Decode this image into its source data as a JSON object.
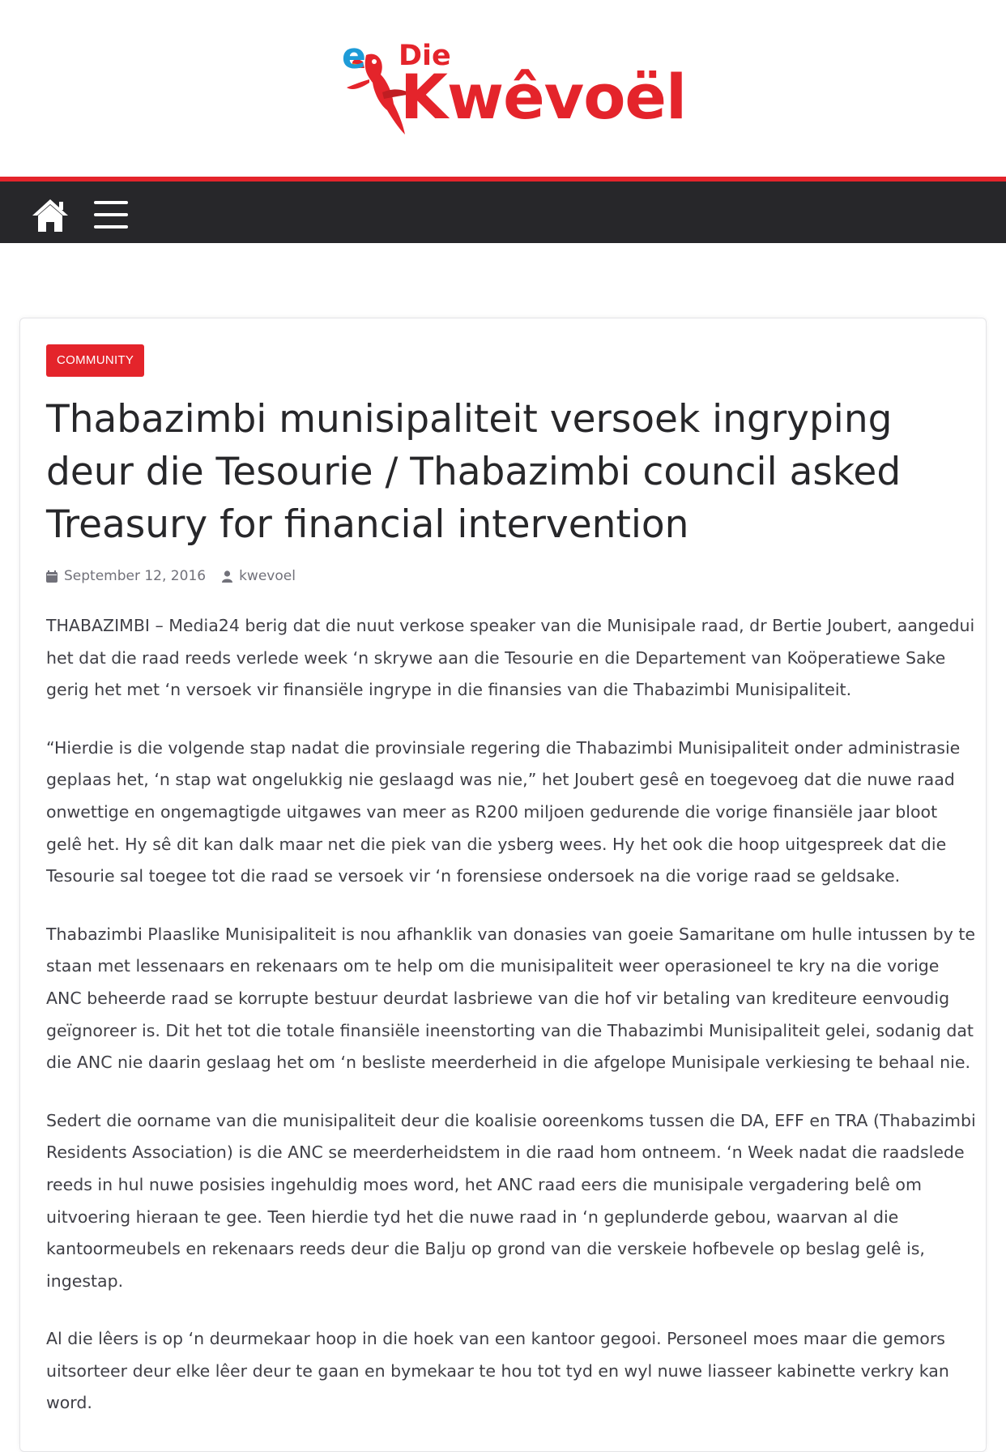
{
  "site": {
    "logo_prefix": "e",
    "logo_small": "Die",
    "logo_name": "Kwêvoël",
    "brand_red": "#e4242b",
    "brand_blue": "#1e9bd7",
    "nav_bg": "#27272a"
  },
  "nav": {
    "home_icon": "home-icon",
    "menu_icon": "hamburger-menu-icon"
  },
  "article": {
    "category": "COMMUNITY",
    "title": "Thabazimbi munisipaliteit versoek ingryping deur die Tesourie / Thabazimbi council asked Treasury for financial intervention",
    "date": "September 12, 2016",
    "author": "kwevoel",
    "paragraphs": [
      "THABAZIMBI – Media24 berig dat die nuut verkose speaker van die Munisipale raad, dr Bertie Joubert, aangedui het dat die raad reeds verlede week ‘n skrywe aan die Tesourie en die Departement van Koöperatiewe Sake gerig het met ‘n versoek vir finansiële ingrype in die finansies van die Thabazimbi Munisipaliteit.",
      "“Hierdie is die volgende stap nadat die provinsiale regering die Thabazimbi Munisipaliteit onder administrasie geplaas het, ‘n stap wat ongelukkig nie geslaagd was nie,” het Joubert gesê en toegevoeg dat die nuwe raad onwettige en ongemagtigde uitgawes van meer as R200 miljoen gedurende die vorige finansiële jaar bloot gelê het. Hy sê dit kan dalk maar net die piek van die ysberg wees. Hy het ook die hoop uitgespreek dat die Tesourie sal toegee tot die raad se versoek vir ‘n forensiese ondersoek na die vorige raad se geldsake.",
      "Thabazimbi Plaaslike Munisipaliteit is nou afhanklik van donasies van goeie Samaritane om hulle intussen by te staan met lessenaars en rekenaars om te help om die munisipaliteit weer operasioneel te kry na die vorige ANC beheerde raad se korrupte bestuur deurdat lasbriewe van die hof vir betaling van krediteure eenvoudig geïgnoreer is. Dit het tot die totale finansiële ineenstorting van die Thabazimbi Munisipaliteit gelei, sodanig dat die ANC nie daarin geslaag het om ‘n besliste meerderheid in die afgelope Munisipale verkiesing te behaal nie.",
      "Sedert die oorname van die munisipaliteit deur die koalisie ooreenkoms tussen die DA, EFF en TRA (Thabazimbi Residents Association) is die ANC se meerderheidstem in die raad hom ontneem. ‘n Week nadat die raadslede reeds in hul nuwe posisies ingehuldig moes word, het ANC raad eers die munisipale vergadering belê om uitvoering hieraan te gee. Teen hierdie tyd het die nuwe raad in ‘n geplunderde gebou, waarvan al die kantoormeubels en rekenaars reeds deur die Balju op grond van die verskeie hofbevele op beslag gelê is, ingestap.",
      "Al die lêers is op ‘n deurmekaar hoop in die hoek van een kantoor gegooi. Personeel moes maar die gemors uitsorteer deur elke lêer deur te gaan en bymekaar te hou tot tyd en wyl nuwe liasseer kabinette verkry kan word."
    ]
  }
}
